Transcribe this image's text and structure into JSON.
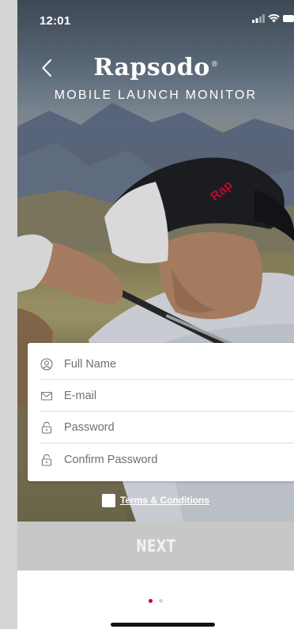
{
  "status_bar": {
    "time": "12:01"
  },
  "header": {
    "brand": "Rapsodo",
    "brand_mark": "®",
    "subtitle": "MOBILE LAUNCH MONITOR"
  },
  "form": {
    "fields": [
      {
        "placeholder": "Full Name",
        "icon": "person-icon"
      },
      {
        "placeholder": "E-mail",
        "icon": "mail-icon"
      },
      {
        "placeholder": "Password",
        "icon": "lock-icon"
      },
      {
        "placeholder": "Confirm Password",
        "icon": "lock-icon"
      }
    ]
  },
  "terms": {
    "label": "Terms & Conditions"
  },
  "next_button": {
    "label": "NEXT"
  },
  "pagination": {
    "total": 2,
    "active": 0
  },
  "colors": {
    "accent": "#d0021b",
    "dot_inactive": "#d3d3d3",
    "button_disabled": "#c7c7c7"
  }
}
